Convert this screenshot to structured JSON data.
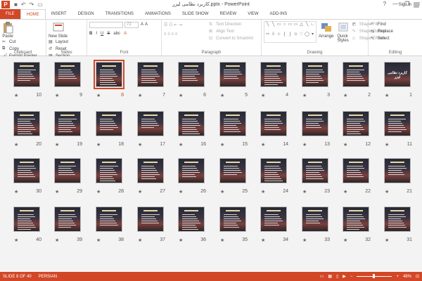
{
  "window": {
    "title": "کاربرد نظامی لیزر.pptx - PowerPoint",
    "app_logo": "P",
    "help": "?",
    "minimize": "—",
    "restore": "❐",
    "close": "✕"
  },
  "qat": [
    "save-icon",
    "undo-icon",
    "redo-icon",
    "start-from-beginning-icon"
  ],
  "tabs": [
    {
      "label": "FILE",
      "kind": "file"
    },
    {
      "label": "HOME",
      "kind": "active"
    },
    {
      "label": "INSERT"
    },
    {
      "label": "DESIGN"
    },
    {
      "label": "TRANSITIONS"
    },
    {
      "label": "ANIMATIONS"
    },
    {
      "label": "SLIDE SHOW"
    },
    {
      "label": "REVIEW"
    },
    {
      "label": "VIEW"
    },
    {
      "label": "ADD-INS"
    }
  ],
  "signin": "Sign in",
  "ribbon": {
    "clipboard": {
      "label": "Clipboard",
      "paste": "Paste",
      "cut": "Cut",
      "copy": "Copy",
      "format_painter": "Format Painter"
    },
    "slides": {
      "label": "Slides",
      "new_slide": "New Slide",
      "layout": "Layout",
      "reset": "Reset",
      "section": "Section"
    },
    "font": {
      "label": "Font",
      "size": "72",
      "bold": "B",
      "italic": "I",
      "underline": "U",
      "strike": "S",
      "shadow": "abc",
      "clear": "A"
    },
    "paragraph": {
      "label": "Paragraph",
      "text_direction": "Text Direction",
      "align_text": "Align Text",
      "smartart": "Convert to SmartArt"
    },
    "drawing": {
      "label": "Drawing",
      "arrange": "Arrange",
      "quick_styles": "Quick Styles",
      "shape_fill": "Shape Fill",
      "shape_outline": "Shape Outline",
      "shape_effects": "Shape Effects"
    },
    "editing": {
      "label": "Editing",
      "find": "Find",
      "replace": "Replace",
      "select": "Select"
    }
  },
  "slides": [
    {
      "num": "1"
    },
    {
      "num": "2"
    },
    {
      "num": "3"
    },
    {
      "num": "4"
    },
    {
      "num": "5"
    },
    {
      "num": "6"
    },
    {
      "num": "7"
    },
    {
      "num": "8",
      "selected": true
    },
    {
      "num": "9"
    },
    {
      "num": "10"
    },
    {
      "num": "11"
    },
    {
      "num": "12"
    },
    {
      "num": "13"
    },
    {
      "num": "14"
    },
    {
      "num": "15"
    },
    {
      "num": "16"
    },
    {
      "num": "17"
    },
    {
      "num": "18"
    },
    {
      "num": "19"
    },
    {
      "num": "20"
    },
    {
      "num": "21"
    },
    {
      "num": "22"
    },
    {
      "num": "23"
    },
    {
      "num": "24"
    },
    {
      "num": "25"
    },
    {
      "num": "26"
    },
    {
      "num": "27"
    },
    {
      "num": "28"
    },
    {
      "num": "29"
    },
    {
      "num": "30"
    },
    {
      "num": "31"
    },
    {
      "num": "32"
    },
    {
      "num": "33"
    },
    {
      "num": "34"
    },
    {
      "num": "35"
    },
    {
      "num": "36"
    },
    {
      "num": "37"
    },
    {
      "num": "38"
    },
    {
      "num": "39"
    },
    {
      "num": "40"
    }
  ],
  "slide1_title": "کاربرد نظامی لیزر",
  "star": "★",
  "status": {
    "slide_info": "SLIDE 8 OF 40",
    "language": "PERSIAN",
    "zoom_minus": "−",
    "zoom_plus": "+",
    "zoom": "48%",
    "zoom_fraction": 0.48
  },
  "colors": {
    "accent": "#d24726"
  }
}
